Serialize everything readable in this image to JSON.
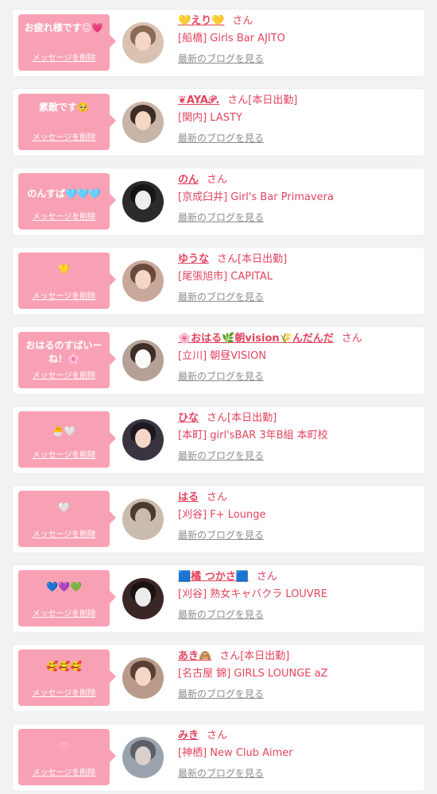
{
  "delete_label": "メッセージを削除",
  "san_label": "さん",
  "blog_label": "最新のブログを見る",
  "cards": [
    {
      "message": "お疲れ様です😖💗",
      "name": "💛えり💛",
      "status": "",
      "shop": "[船橋] Girls Bar AJITO"
    },
    {
      "message": "素敵です🥺",
      "name": "❦AYA𝒫.",
      "status": "[本日出勤]",
      "shop": "[関内] LASTY"
    },
    {
      "message": "のんすぱ🩵🩵🩵",
      "name": "のん",
      "status": "",
      "shop": "[京成臼井] Girl's Bar Primavera"
    },
    {
      "message": "💛",
      "name": "ゆうな",
      "status": "[本日出勤]",
      "shop": "[尾張旭市] CAPITAL"
    },
    {
      "message": "おはるのすばいーね！🌸",
      "name": "🌸おはる🌿朝vision🌾んだんだ",
      "status": "",
      "shop": "[立川] 朝昼VISION"
    },
    {
      "message": "🐣🤍",
      "name": "ひな",
      "status": "[本日出勤]",
      "shop": "[本町] girl'sBAR 3年B組 本町校"
    },
    {
      "message": "🤍",
      "name": "はる",
      "status": "",
      "shop": "[刈谷] F+ Lounge"
    },
    {
      "message": "💙💜💚",
      "name": "🟦橘 つかさ🟦",
      "status": "",
      "shop": "[刈谷] 熟女キャバクラ LOUVRE"
    },
    {
      "message": "🥰🥰🥰",
      "name": "あき🙈",
      "status": "[本日出勤]",
      "shop": "[名古屋 錦] GIRLS LOUNGE aZ"
    },
    {
      "message": "♡",
      "name": "みき",
      "status": "",
      "shop": "[神栖] New Club Aimer"
    }
  ]
}
